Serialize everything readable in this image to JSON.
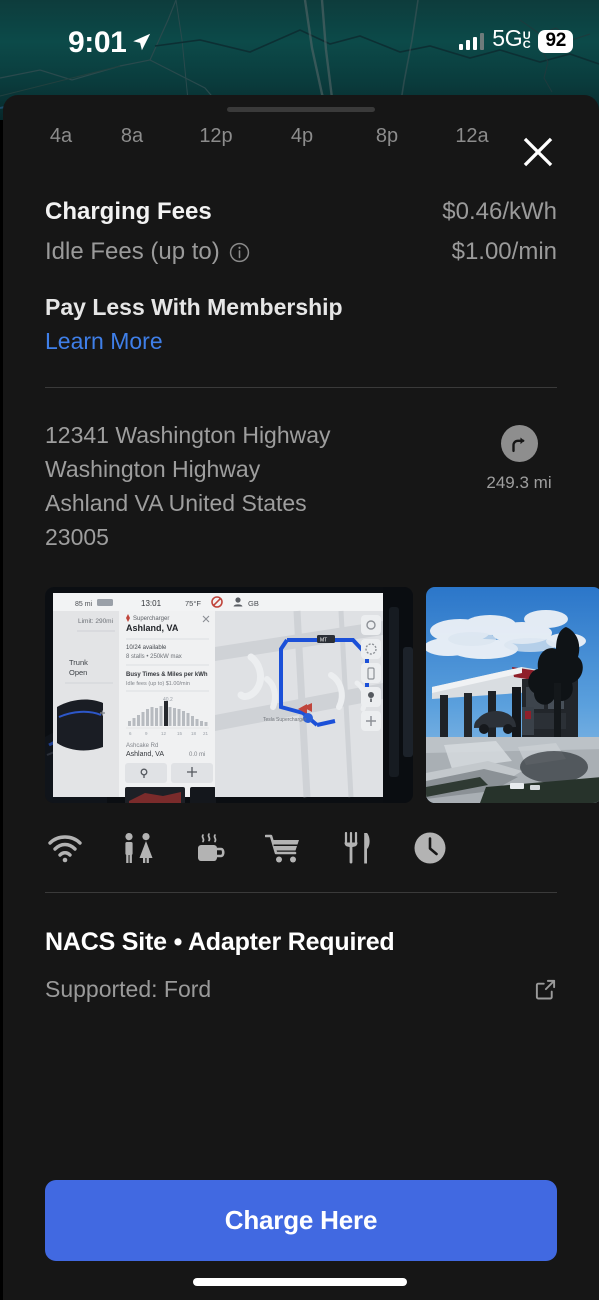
{
  "status_bar": {
    "time": "9:01",
    "location_arrow_icon": "location-arrow-icon",
    "signal_icon": "cellular-signal-icon",
    "network": "5G",
    "network_superscript": "U",
    "network_subscript": "C",
    "battery_percent": "92"
  },
  "sheet": {
    "grabber": "drag-handle",
    "close_icon": "close-icon"
  },
  "busy_chart": {
    "axis_ticks": [
      "4a",
      "8a",
      "12p",
      "4p",
      "8p",
      "12a"
    ]
  },
  "fees": {
    "charging_label": "Charging Fees",
    "charging_value": "$0.46/kWh",
    "idle_label": "Idle Fees (up to)",
    "idle_info_icon": "info-circle-icon",
    "idle_value": "$1.00/min"
  },
  "membership": {
    "title": "Pay Less With Membership",
    "link": "Learn More",
    "link_color": "#3f7fe8"
  },
  "address": {
    "lines": [
      "12341 Washington Highway",
      "Washington Highway",
      "Ashland VA United States",
      "23005"
    ],
    "directions_icon": "directions-arrow-icon",
    "distance": "249.3 mi"
  },
  "photos": [
    {
      "name": "photo-tesla-screen",
      "alt": "Tesla touchscreen showing Supercharger Ashland VA"
    },
    {
      "name": "photo-station-canopy",
      "alt": "Charging station canopy exterior"
    }
  ],
  "amenities": [
    {
      "icon": "wifi-icon",
      "label": "WiFi"
    },
    {
      "icon": "restroom-icon",
      "label": "Restrooms"
    },
    {
      "icon": "coffee-icon",
      "label": "Coffee"
    },
    {
      "icon": "shopping-cart-icon",
      "label": "Shopping"
    },
    {
      "icon": "restaurant-icon",
      "label": "Dining"
    },
    {
      "icon": "clock-24h-icon",
      "label": "Open 24 Hours"
    }
  ],
  "connector": {
    "title": "NACS Site •  Adapter Required",
    "supported": "Supported: Ford",
    "external_link_icon": "external-link-icon"
  },
  "primary_action": {
    "label": "Charge Here",
    "color": "#4169e1"
  },
  "home_indicator": "home-indicator"
}
